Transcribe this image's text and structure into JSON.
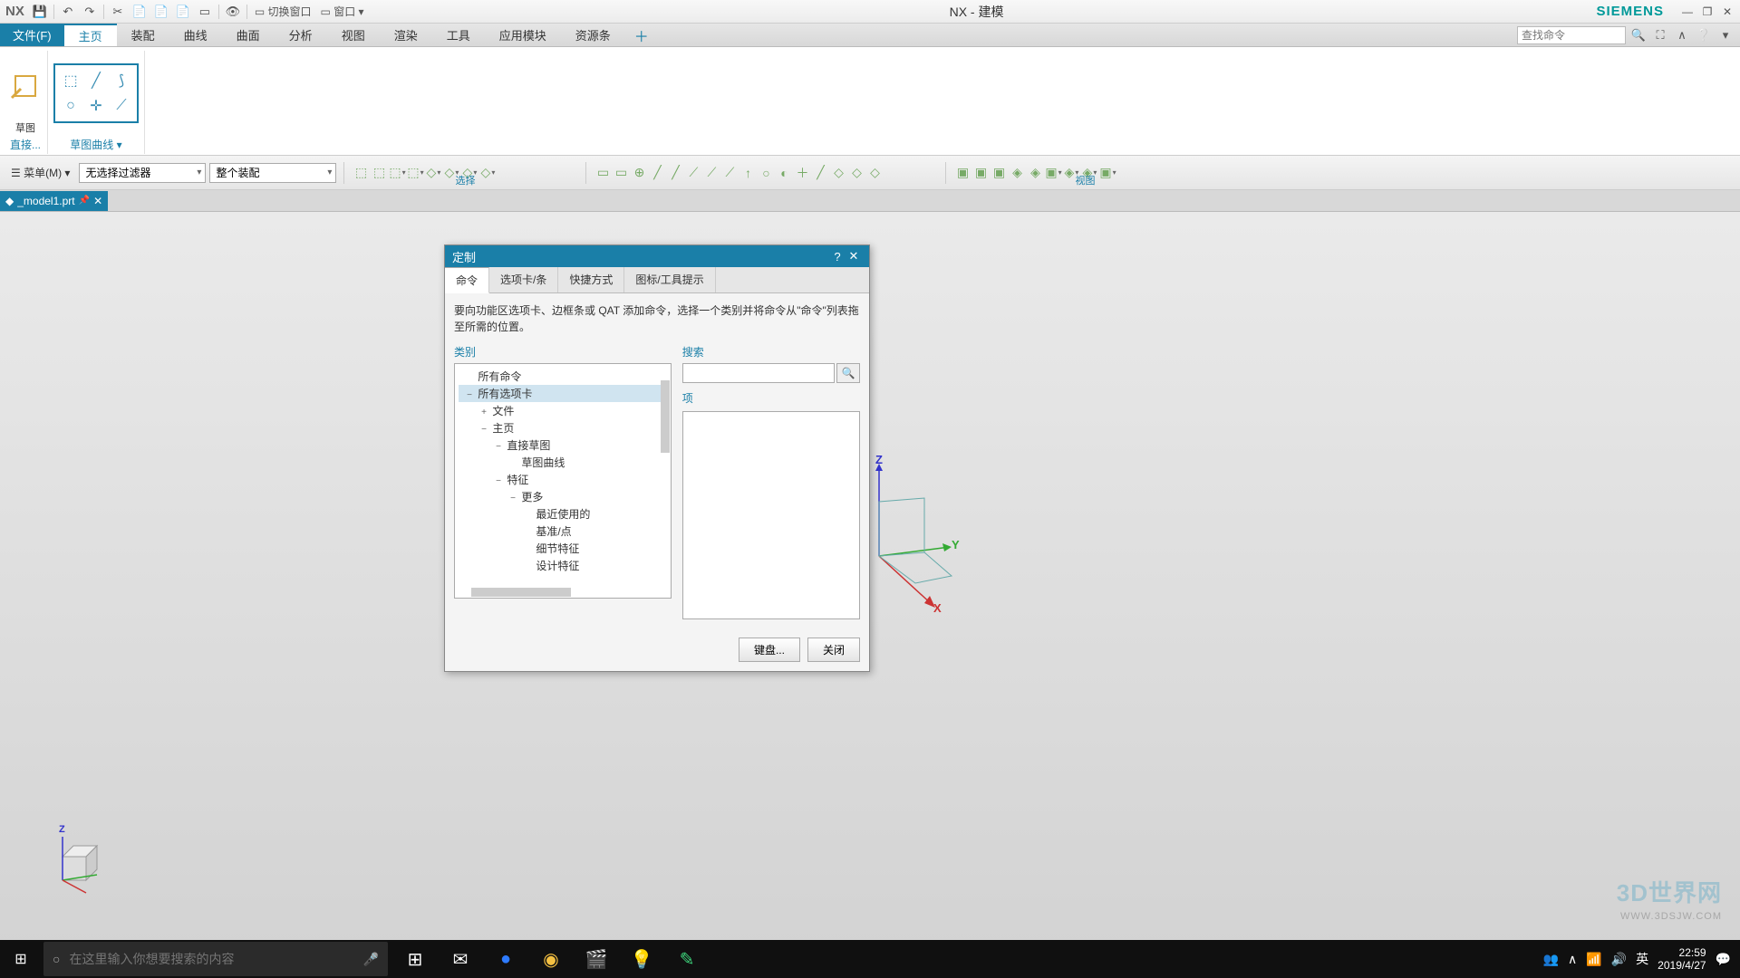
{
  "titlebar": {
    "logo": "NX",
    "qat_items": [
      "💾",
      "↶",
      "↷",
      "✂",
      "📄",
      "📄",
      "📄",
      "▭"
    ],
    "qat_sep1": true,
    "qat_eye": "👁",
    "switch_window": "切换窗口",
    "window_menu": "窗口",
    "title": "NX - 建模",
    "brand": "SIEMENS",
    "win_min": "—",
    "win_restore": "❐",
    "win_close": "✕"
  },
  "menubar": {
    "file": "文件(F)",
    "tabs": [
      "主页",
      "装配",
      "曲线",
      "曲面",
      "分析",
      "视图",
      "渲染",
      "工具",
      "应用模块",
      "资源条"
    ],
    "active_tab": "主页",
    "search_placeholder": "查找命令",
    "right_icons": [
      "⛶",
      "∧",
      "❔",
      "▾"
    ]
  },
  "ribbon": {
    "sketch_group": "直接...",
    "sketch_label": "草图",
    "curves_group": "草图曲线",
    "curves_dropdown": "▾"
  },
  "selbar": {
    "menu_btn": "菜单(M)",
    "filter": "无选择过滤器",
    "assembly": "整个装配",
    "sel_label": "选择",
    "view_label": "视图"
  },
  "tabstrip": {
    "doc_name": "_model1.prt",
    "pin": "📌",
    "close": "✕"
  },
  "dialog": {
    "title": "定制",
    "help": "?",
    "close": "✕",
    "tabs": [
      "命令",
      "选项卡/条",
      "快捷方式",
      "图标/工具提示"
    ],
    "active_tab": "命令",
    "description": "要向功能区选项卡、边框条或 QAT 添加命令，选择一个类别并将命令从\"命令\"列表拖至所需的位置。",
    "category_label": "类别",
    "search_label": "搜索",
    "items_label": "项",
    "tree": [
      {
        "indent": 0,
        "toggle": "",
        "label": "所有命令"
      },
      {
        "indent": 0,
        "toggle": "−",
        "label": "所有选项卡",
        "sel": true
      },
      {
        "indent": 1,
        "toggle": "+",
        "label": "文件"
      },
      {
        "indent": 1,
        "toggle": "−",
        "label": "主页"
      },
      {
        "indent": 2,
        "toggle": "−",
        "label": "直接草图"
      },
      {
        "indent": 3,
        "toggle": "",
        "label": "草图曲线"
      },
      {
        "indent": 2,
        "toggle": "−",
        "label": "特征"
      },
      {
        "indent": 3,
        "toggle": "−",
        "label": "更多"
      },
      {
        "indent": 4,
        "toggle": "",
        "label": "最近使用的"
      },
      {
        "indent": 4,
        "toggle": "",
        "label": "基准/点"
      },
      {
        "indent": 4,
        "toggle": "",
        "label": "细节特征"
      },
      {
        "indent": 4,
        "toggle": "",
        "label": "设计特征"
      }
    ],
    "keyboard_btn": "键盘...",
    "close_btn": "关闭"
  },
  "axis": {
    "x": "X",
    "y": "Y",
    "z": "Z"
  },
  "watermark": {
    "main": "3D世界网",
    "sub": "WWW.3DSJW.COM"
  },
  "taskbar": {
    "search_placeholder": "在这里输入你想要搜索的内容",
    "apps": [
      {
        "name": "task-view",
        "glyph": "⊞",
        "color": "#fff"
      },
      {
        "name": "mail",
        "glyph": "✉",
        "color": "#fff"
      },
      {
        "name": "kugou",
        "glyph": "●",
        "color": "#2e7bff"
      },
      {
        "name": "chrome",
        "glyph": "◉",
        "color": "#f4c042"
      },
      {
        "name": "movies",
        "glyph": "🎬",
        "color": "#fff"
      },
      {
        "name": "paint3d",
        "glyph": "💡",
        "color": "#ff5fb0"
      },
      {
        "name": "youdao",
        "glyph": "✎",
        "color": "#3dd17a"
      }
    ],
    "tray_icons": [
      "👥",
      "∧",
      "📶",
      "🔊",
      "英"
    ],
    "time": "22:59",
    "date": "2019/4/27",
    "notif": "💬"
  }
}
